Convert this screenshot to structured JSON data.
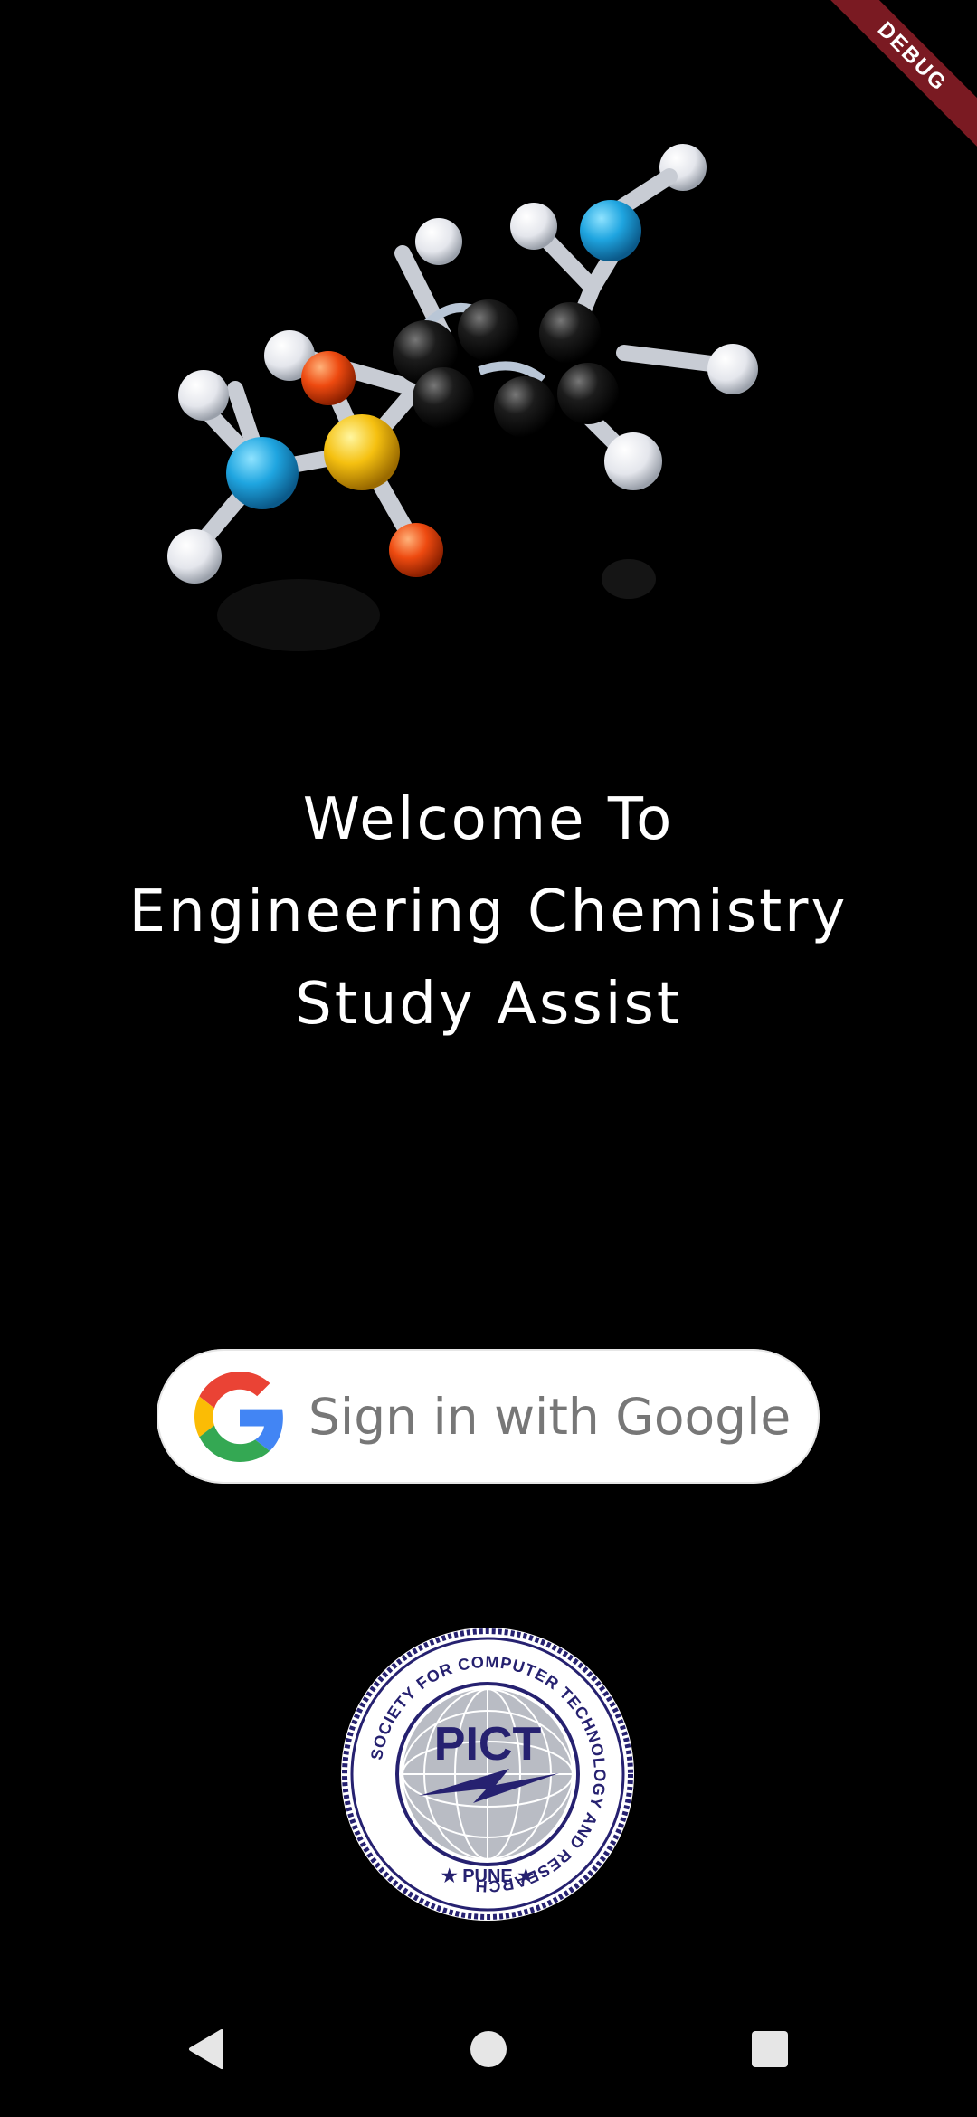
{
  "debug_banner": {
    "label": "DEBUG"
  },
  "welcome": {
    "line1": "Welcome To",
    "line2": "Engineering Chemistry",
    "line3": "Study Assist"
  },
  "google_button": {
    "label": "Sign in with Google",
    "icon": "google-g-icon"
  },
  "logo": {
    "abbreviation": "PICT",
    "ring_text": "SOCIETY FOR COMPUTER TECHNOLOGY AND RESEARCH",
    "city": "PUNE"
  },
  "navigation": {
    "back_icon": "back-triangle-icon",
    "home_icon": "home-circle-icon",
    "recents_icon": "recents-square-icon"
  },
  "colors": {
    "background": "#000000",
    "button_bg": "#ffffff",
    "button_text": "#777777",
    "debug_ribbon": "#7a1a22",
    "logo_navy": "#262170"
  }
}
